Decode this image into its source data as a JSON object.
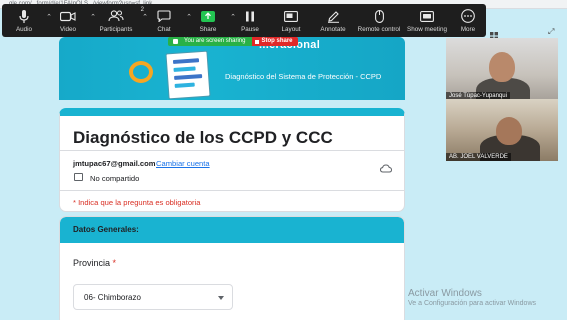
{
  "browser": {
    "url_fragment": "...gle.com/...form/d/e/1FAIpQLS.../viewform?usp=sf_link"
  },
  "zoom_toolbar": {
    "items": [
      {
        "label": "Audio",
        "icon": "microphone-icon",
        "caret": true
      },
      {
        "label": "Video",
        "icon": "video-camera-icon",
        "caret": true
      },
      {
        "label": "Participants",
        "icon": "participants-icon",
        "count": "2",
        "caret": true
      },
      {
        "label": "Chat",
        "icon": "chat-icon",
        "caret": true
      },
      {
        "label": "Share",
        "icon": "share-screen-icon",
        "caret": true
      },
      {
        "label": "Pause",
        "icon": "pause-icon",
        "caret": false
      },
      {
        "label": "Layout",
        "icon": "layout-icon",
        "caret": false
      },
      {
        "label": "Annotate",
        "icon": "annotate-pen-icon",
        "caret": false
      },
      {
        "label": "Remote control",
        "icon": "mouse-icon",
        "caret": false
      },
      {
        "label": "Show meeting",
        "icon": "show-meeting-icon",
        "caret": false
      },
      {
        "label": "More",
        "icon": "more-dots-icon",
        "caret": false
      }
    ],
    "share_accent": "#23c552"
  },
  "screen_share": {
    "status": "You are screen sharing",
    "stop_label": "Stop share",
    "status_color": "#29b146",
    "stop_color": "#e02828"
  },
  "form": {
    "banner_title": "...eracional",
    "banner_subtitle": "Diagnóstico del Sistema de Protección - CCPD",
    "title": "Diagnóstico de los CCPD y CCC",
    "account_email": "jmtupac67@gmail.com",
    "switch_account": "Cambiar cuenta",
    "not_shared": "No compartido",
    "required_note": "* Indica que la pregunta es obligatoria",
    "section_title": "Datos Generales:",
    "question_label": "Provincia",
    "required_star": "*",
    "selected_option": "06- Chimborazo",
    "accent_color": "#19b3d1"
  },
  "participants": [
    {
      "name": "José Túpac-Yupanqui"
    },
    {
      "name": "AB. JOEL VALVERDE"
    }
  ],
  "watermark": {
    "title": "Activar Windows",
    "subtitle": "Ve a Configuración para activar Windows"
  }
}
